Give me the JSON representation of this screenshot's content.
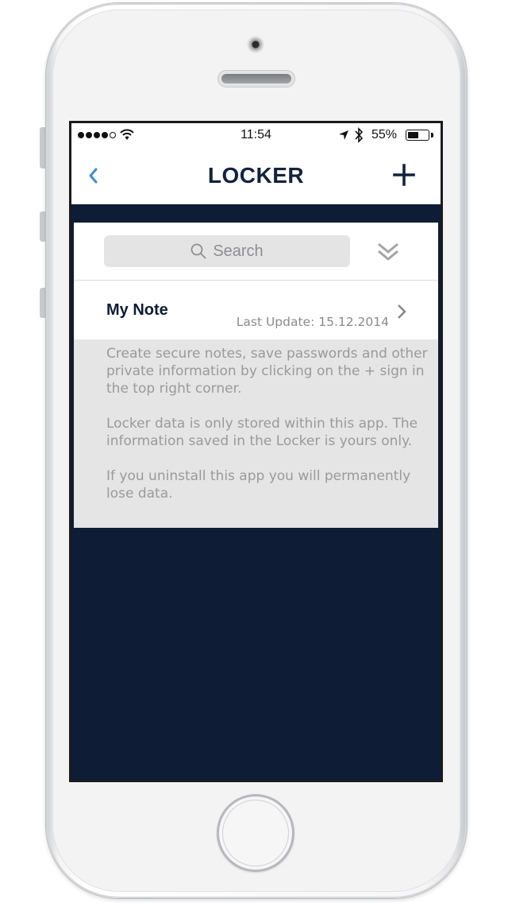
{
  "status_bar": {
    "signal_bars_filled": 4,
    "signal_bars_total": 5,
    "time": "11:54",
    "battery_percent_label": "55%",
    "battery_level": 0.55
  },
  "nav": {
    "title": "LOCKER",
    "back_icon": "chevron-left-icon",
    "add_icon": "plus-icon"
  },
  "search": {
    "placeholder": "Search",
    "icon": "magnifier-icon",
    "expand_icon": "double-chevron-down-icon"
  },
  "notes": [
    {
      "title": "My Note",
      "last_update": "Last Update: 15.12.2014"
    }
  ],
  "info": {
    "paragraphs": [
      "Create secure notes, save passwords and other private information by clicking on the + sign in the top right corner.",
      "Locker data is only stored within this app. The information saved in the Locker is yours only.",
      "If you uninstall this app you will permanently lose data."
    ]
  },
  "colors": {
    "navy": "#0e1c36",
    "accent_blue": "#3a8fd6",
    "light_gray": "#e5e5e5",
    "info_text": "#9a9a9a"
  }
}
